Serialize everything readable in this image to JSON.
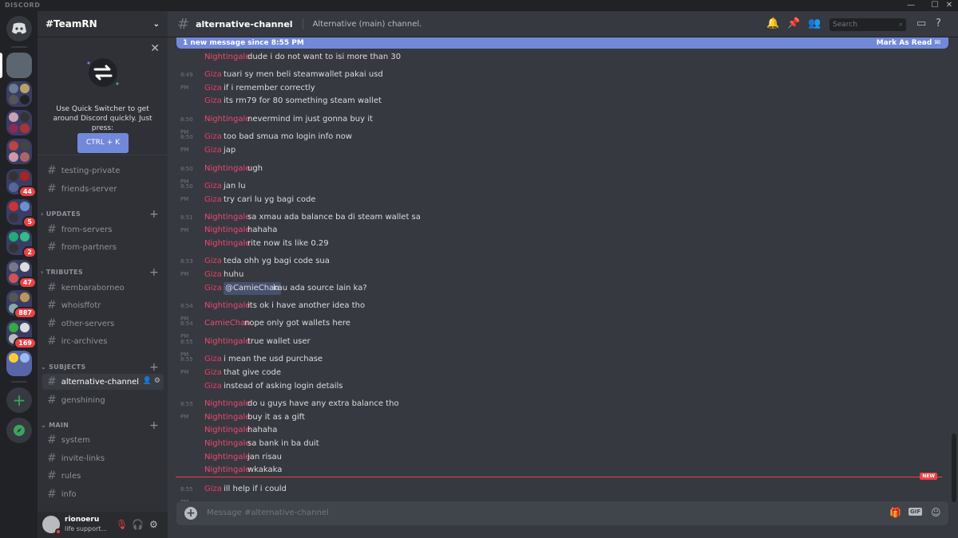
{
  "window": {
    "brand": "DISCORD",
    "controls": [
      "—",
      "☐",
      "✕"
    ]
  },
  "guilds": {
    "badges": [
      "44",
      "5",
      "2",
      "47",
      "887",
      "169"
    ]
  },
  "server": {
    "name": "#TeamRN",
    "quick_switcher": {
      "text": "Use Quick Switcher to get around Discord quickly. Just press:",
      "button": "CTRL + K"
    }
  },
  "sidebar": {
    "channels_top": [
      "testing-private",
      "friends-server"
    ],
    "categories": [
      {
        "name": "UPDATES",
        "channels": [
          "from-servers",
          "from-partners"
        ]
      },
      {
        "name": "TRIBUTES",
        "channels": [
          "kembaraborneo",
          "whoisffotr",
          "other-servers",
          "irc-archives"
        ]
      },
      {
        "name": "SUBJECTS",
        "channels": [
          "alternative-channel",
          "genshining"
        ]
      },
      {
        "name": "MAIN",
        "channels": [
          "system",
          "invite-links",
          "rules",
          "info"
        ]
      }
    ],
    "active_channel": "alternative-channel"
  },
  "user": {
    "name": "rionoeru",
    "status": "life support..."
  },
  "channel": {
    "name": "alternative-channel",
    "topic": "Alternative (main) channel.",
    "search_placeholder": "Search"
  },
  "new_messages": {
    "banner": "1 new message since 8:55 PM",
    "mark_read": "Mark As Read",
    "tag": "NEW"
  },
  "colors": {
    "nightingale": "#f04770",
    "giza": "#e83e64",
    "camiechan": "#f0477b",
    "accent": "#7289da"
  },
  "messages": [
    {
      "ts": "",
      "author": "Nightingale",
      "text": "dude i do not want to isi more than 30"
    },
    {
      "ts": "8:49 PM",
      "author": "Giza",
      "text": "tuari sy men beli steamwallet pakai usd"
    },
    {
      "ts": "",
      "author": "Giza",
      "text": "if i remember correctly"
    },
    {
      "ts": "",
      "author": "Giza",
      "text": "its rm79 for 80 something steam wallet"
    },
    {
      "ts": "8:50 PM",
      "author": "Nightingale",
      "text": "nevermind im just gonna buy it"
    },
    {
      "ts": "8:50 PM",
      "author": "Giza",
      "text": "too bad smua mo login info now"
    },
    {
      "ts": "",
      "author": "Giza",
      "text": "jap"
    },
    {
      "ts": "8:50 PM",
      "author": "Nightingale",
      "text": "ugh"
    },
    {
      "ts": "8:50 PM",
      "author": "Giza",
      "text": "jan lu"
    },
    {
      "ts": "",
      "author": "Giza",
      "text": "try cari lu yg bagi code"
    },
    {
      "ts": "8:51 PM",
      "author": "Nightingale",
      "text": "sa xmau ada balance ba di steam wallet sa"
    },
    {
      "ts": "",
      "author": "Nightingale",
      "text": "hahaha"
    },
    {
      "ts": "",
      "author": "Nightingale",
      "text": "rite now its like 0.29"
    },
    {
      "ts": "8:53 PM",
      "author": "Giza",
      "text": "teda ohh yg bagi code sua"
    },
    {
      "ts": "",
      "author": "Giza",
      "text": "huhu"
    },
    {
      "ts": "",
      "author": "Giza",
      "mention": "@CamieChan",
      "text": "kau ada source lain ka?"
    },
    {
      "ts": "8:54 PM",
      "author": "Nightingale",
      "text": "its ok i have another idea tho"
    },
    {
      "ts": "8:54 PM",
      "author": "CamieChan",
      "text": "nope only got wallets here"
    },
    {
      "ts": "8:55 PM",
      "author": "Nightingale",
      "text": "true wallet user"
    },
    {
      "ts": "8:55 PM",
      "author": "Giza",
      "text": "i mean the usd purchase"
    },
    {
      "ts": "",
      "author": "Giza",
      "text": "that give code"
    },
    {
      "ts": "",
      "author": "Giza",
      "text": "instead of asking login details"
    },
    {
      "ts": "8:55 PM",
      "author": "Nightingale",
      "text": "do u guys have any extra balance tho"
    },
    {
      "ts": "",
      "author": "Nightingale",
      "text": "buy it as a gift"
    },
    {
      "ts": "",
      "author": "Nightingale",
      "text": "hahaha"
    },
    {
      "ts": "",
      "author": "Nightingale",
      "text": "sa bank in ba duit"
    },
    {
      "ts": "",
      "author": "Nightingale",
      "text": "jan risau"
    },
    {
      "ts": "",
      "author": "Nightingale",
      "text": "wkakaka"
    },
    {
      "ts": "8:55 PM",
      "author": "Giza",
      "text": "ill help if i could"
    }
  ],
  "composer": {
    "placeholder": "Message #alternative-channel",
    "gif": "GIF"
  }
}
